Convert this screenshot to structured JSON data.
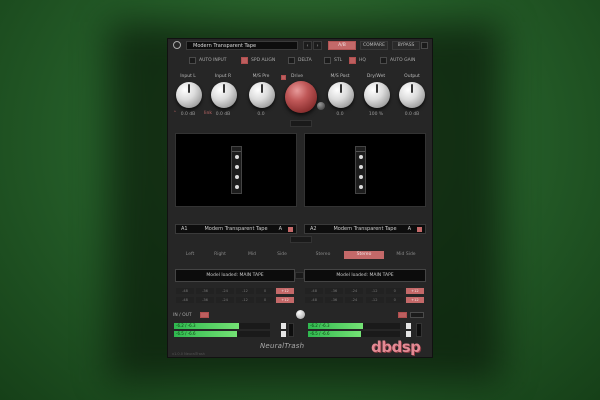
{
  "header": {
    "preset_name": "Modern Transparent Tape",
    "nav_prev": "‹",
    "nav_next": "›",
    "buttons": [
      {
        "label": "A/B",
        "active": true
      },
      {
        "label": "COMPARE",
        "active": false
      },
      {
        "label": "BYPASS",
        "active": false
      }
    ]
  },
  "options": [
    {
      "label": "AUTO INPUT",
      "on": false
    },
    {
      "label": "SPD ALIGN",
      "on": true
    },
    {
      "label": "DELTA",
      "on": false
    },
    {
      "label": "STL",
      "on": false
    },
    {
      "label": "HQ",
      "on": true
    },
    {
      "label": "AUTO GAIN",
      "on": false
    }
  ],
  "knobs": [
    {
      "label": "Input L",
      "value": "0.0 dB"
    },
    {
      "label": "Input R",
      "value": "0.0 dB"
    },
    {
      "label": "M/S Pre",
      "value": "0.0"
    },
    {
      "label": "Drive",
      "value": ""
    },
    {
      "label": "M/S Post",
      "value": "0.0"
    },
    {
      "label": "Dry/Wet",
      "value": "100 %"
    },
    {
      "label": "Output",
      "value": "0.0 dB"
    }
  ],
  "link_label": "link",
  "slots": {
    "left": {
      "id": "A1",
      "name": "Modern Transparent Tape",
      "variant": "A"
    },
    "right": {
      "id": "A2",
      "name": "Modern Transparent Tape",
      "variant": "A"
    }
  },
  "tabs_left": [
    {
      "label": "Left",
      "active": false
    },
    {
      "label": "Right",
      "active": false
    },
    {
      "label": "Mid",
      "active": false
    },
    {
      "label": "Side",
      "active": false
    }
  ],
  "tabs_right": [
    {
      "label": "Stereo",
      "active": false
    },
    {
      "label": "Stereo",
      "active": true
    },
    {
      "label": "Mid Side",
      "active": false
    }
  ],
  "status": {
    "left": "Model loaded: MAIN TAPE",
    "right": "Model loaded: MAIN TAPE"
  },
  "grid_left": [
    "-48",
    "-36",
    "-24",
    "-12",
    "0",
    "+12",
    "-48",
    "-36",
    "-24",
    "-12",
    "0",
    "+12"
  ],
  "grid_right": [
    "-48",
    "-36",
    "-24",
    "-12",
    "0",
    "+12",
    "-48",
    "-36",
    "-24",
    "-12",
    "0",
    "+12"
  ],
  "meters": {
    "section_label": "IN / OUT",
    "rows": [
      {
        "side": "left",
        "text": "-6.2 / -6.3",
        "fill": 0.68
      },
      {
        "side": "left",
        "text": "-6.5 / -6.6",
        "fill": 0.66
      },
      {
        "side": "right",
        "text": "-6.2 / -6.3",
        "fill": 0.6
      },
      {
        "side": "right",
        "text": "-6.5 / -6.6",
        "fill": 0.58
      }
    ]
  },
  "branding": {
    "product": "NeuralTrash",
    "company": "dbdsp"
  },
  "footer_text": "v1.0.0 NeuralTrash"
}
